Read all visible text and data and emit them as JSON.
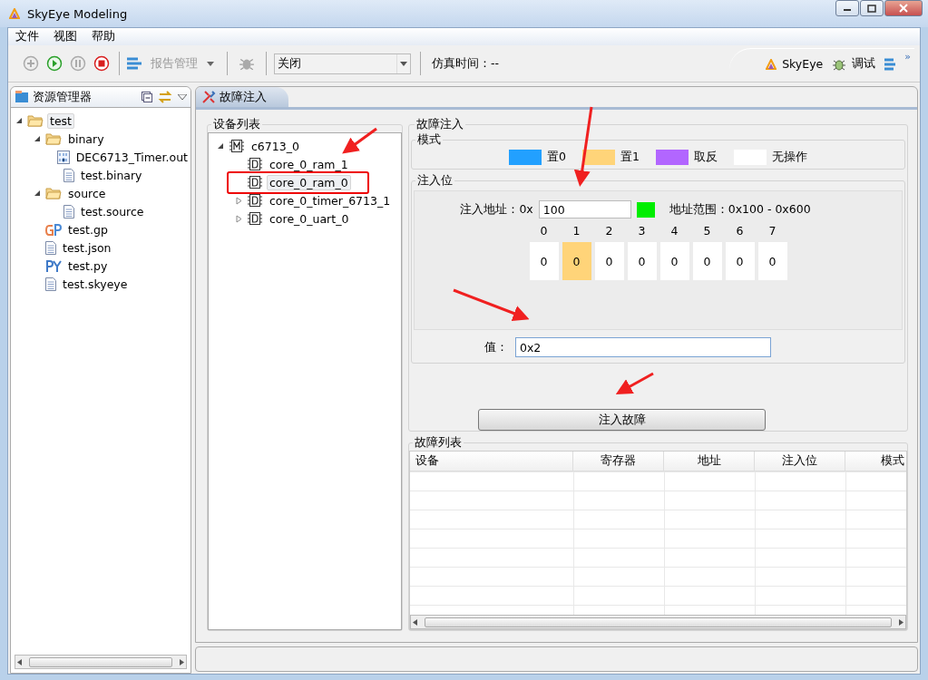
{
  "window": {
    "title": "SkyEye Modeling"
  },
  "menu": [
    "文件",
    "视图",
    "帮助"
  ],
  "toolbar": {
    "report": "报告管理",
    "mode_value": "关闭",
    "sim_time": "仿真时间：--",
    "perspectives": [
      {
        "label": "SkyEye",
        "kind": "skyeye"
      },
      {
        "label": "调试",
        "kind": "debug"
      }
    ],
    "more": "»"
  },
  "explorer": {
    "title": "资源管理器",
    "tree": [
      {
        "label": "test",
        "kind": "project",
        "expanded": true,
        "selected": true,
        "children": [
          {
            "label": "binary",
            "kind": "folder",
            "expanded": true,
            "selected": false,
            "children": [
              {
                "label": "DEC6713_Timer.out",
                "kind": "binary",
                "selected": false
              },
              {
                "label": "test.binary",
                "kind": "file",
                "selected": false
              }
            ]
          },
          {
            "label": "source",
            "kind": "folder",
            "expanded": true,
            "selected": false,
            "children": [
              {
                "label": "test.source",
                "kind": "file",
                "selected": false
              }
            ]
          },
          {
            "label": "test.gp",
            "kind": "gp",
            "selected": false
          },
          {
            "label": "test.json",
            "kind": "file",
            "selected": false
          },
          {
            "label": "test.py",
            "kind": "py",
            "selected": false
          },
          {
            "label": "test.skyeye",
            "kind": "file",
            "selected": false
          }
        ]
      }
    ]
  },
  "editor_tab": {
    "title": "故障注入"
  },
  "device_list": {
    "title": "设备列表",
    "tree": [
      {
        "label": "c6713_0",
        "kind": "machine",
        "expanded": true,
        "selected": false,
        "marked": false,
        "children": [
          {
            "label": "core_0_ram_1",
            "kind": "device",
            "selected": false,
            "marked": false
          },
          {
            "label": "core_0_ram_0",
            "kind": "device",
            "selected": true,
            "marked": true
          },
          {
            "label": "core_0_timer_6713_1",
            "kind": "device",
            "expanded": false,
            "selected": false,
            "marked": false
          },
          {
            "label": "core_0_uart_0",
            "kind": "device",
            "expanded": false,
            "selected": false,
            "marked": false
          }
        ]
      }
    ]
  },
  "fault_injection": {
    "title": "故障注入",
    "mode_title": "模式",
    "modes": [
      {
        "label": "置0",
        "color": "#22a0ff"
      },
      {
        "label": "置1",
        "color": "#ffd479"
      },
      {
        "label": "取反",
        "color": "#b266ff"
      },
      {
        "label": "无操作",
        "color": "#ffffff"
      }
    ],
    "bits_title": "注入位",
    "address_label": "注入地址：0x",
    "address_value": "100",
    "address_valid": true,
    "range": "地址范围：0x100 - 0x600",
    "bits": [
      {
        "index": "0",
        "value": "0",
        "color": "#ffffff"
      },
      {
        "index": "1",
        "value": "0",
        "color": "#ffd479"
      },
      {
        "index": "2",
        "value": "0",
        "color": "#ffffff"
      },
      {
        "index": "3",
        "value": "0",
        "color": "#ffffff"
      },
      {
        "index": "4",
        "value": "0",
        "color": "#ffffff"
      },
      {
        "index": "5",
        "value": "0",
        "color": "#ffffff"
      },
      {
        "index": "6",
        "value": "0",
        "color": "#ffffff"
      },
      {
        "index": "7",
        "value": "0",
        "color": "#ffffff"
      }
    ],
    "value_label": "值：",
    "value": "0x2",
    "button": "注入故障"
  },
  "fault_list": {
    "title": "故障列表",
    "columns": [
      "设备",
      "寄存器",
      "地址",
      "注入位",
      "模式"
    ]
  }
}
